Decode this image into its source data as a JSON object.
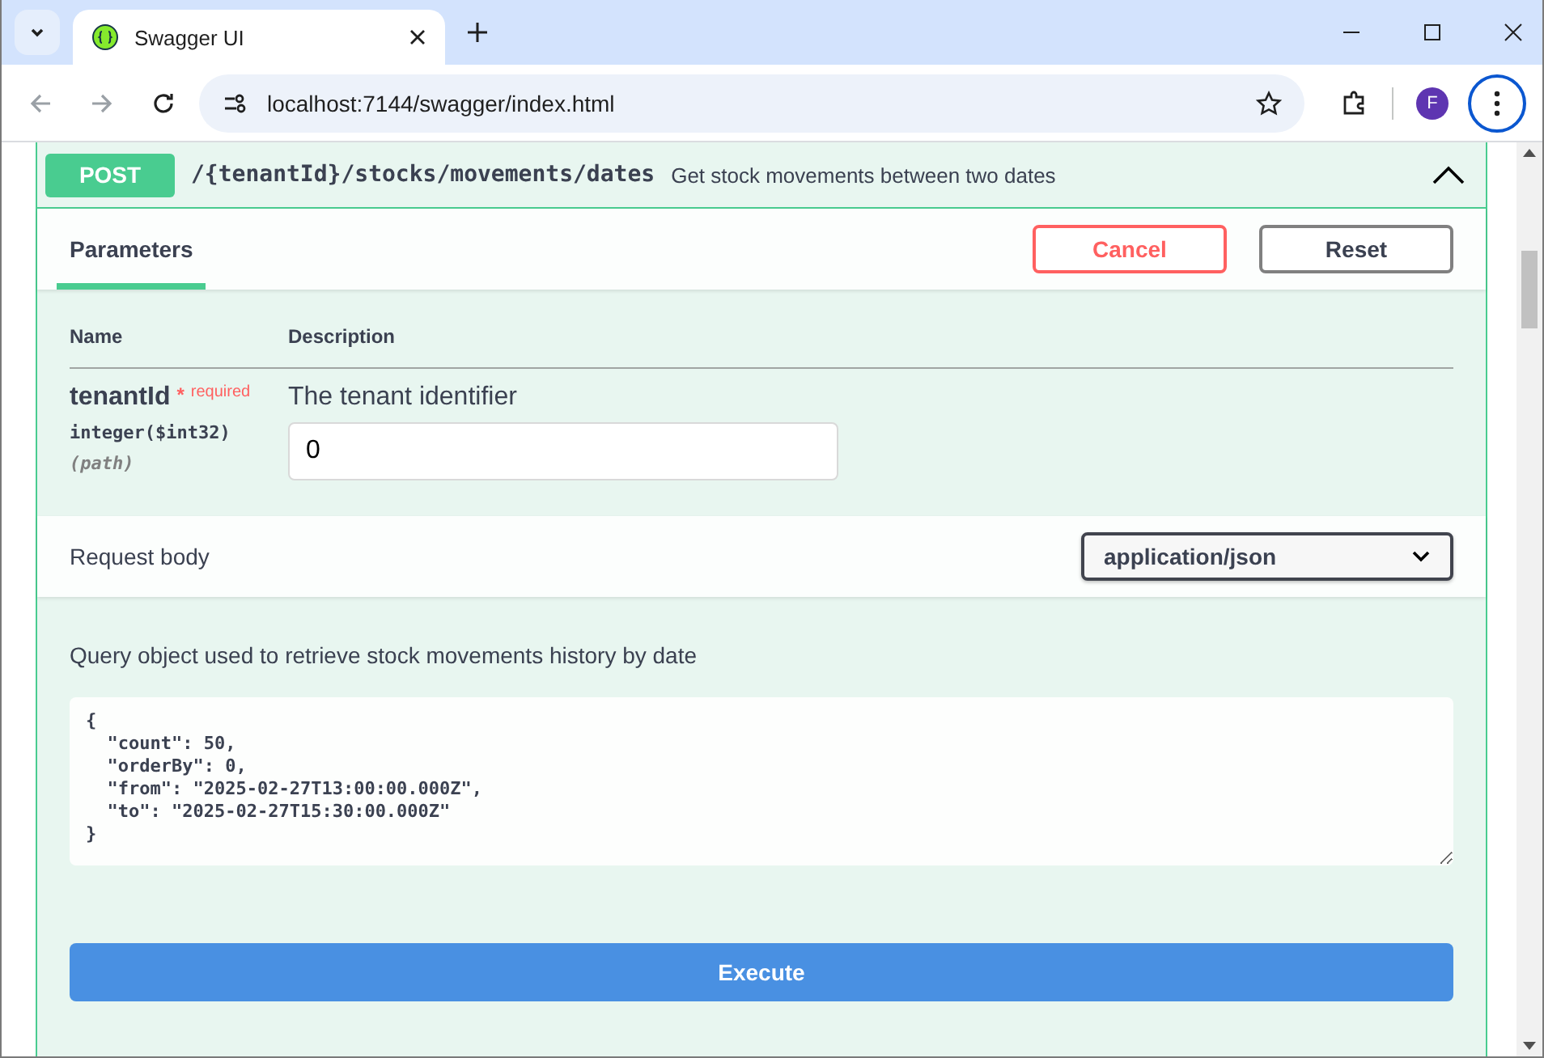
{
  "browser": {
    "tab_title": "Swagger UI",
    "url": "localhost:7144/swagger/index.html",
    "profile_initial": "F"
  },
  "operation": {
    "method": "POST",
    "path": "/{tenantId}/stocks/movements/dates",
    "summary": "Get stock movements between two dates",
    "expanded": true
  },
  "section_tabs": [
    {
      "label": "Parameters",
      "selected": true
    }
  ],
  "buttons": [
    {
      "label": "Cancel",
      "kind": "cancel"
    },
    {
      "label": "Reset",
      "kind": "reset"
    }
  ],
  "parameters_table": {
    "columns": [
      "Name",
      "Description"
    ],
    "rows": [
      {
        "name": "tenantId",
        "required_mark": "*",
        "required_label": "required",
        "type": "integer($int32)",
        "location": "(path)",
        "description": "The tenant identifier",
        "value": "0"
      }
    ]
  },
  "request_body": {
    "label": "Request body",
    "content_type": "application/json",
    "description": "Query object used to retrieve stock movements history by date",
    "body": "{\n  \"count\": 50,\n  \"orderBy\": 0,\n  \"from\": \"2025-02-27T13:00:00.000Z\",\n  \"to\": \"2025-02-27T15:30:00.000Z\"\n}"
  },
  "execute_label": "Execute"
}
